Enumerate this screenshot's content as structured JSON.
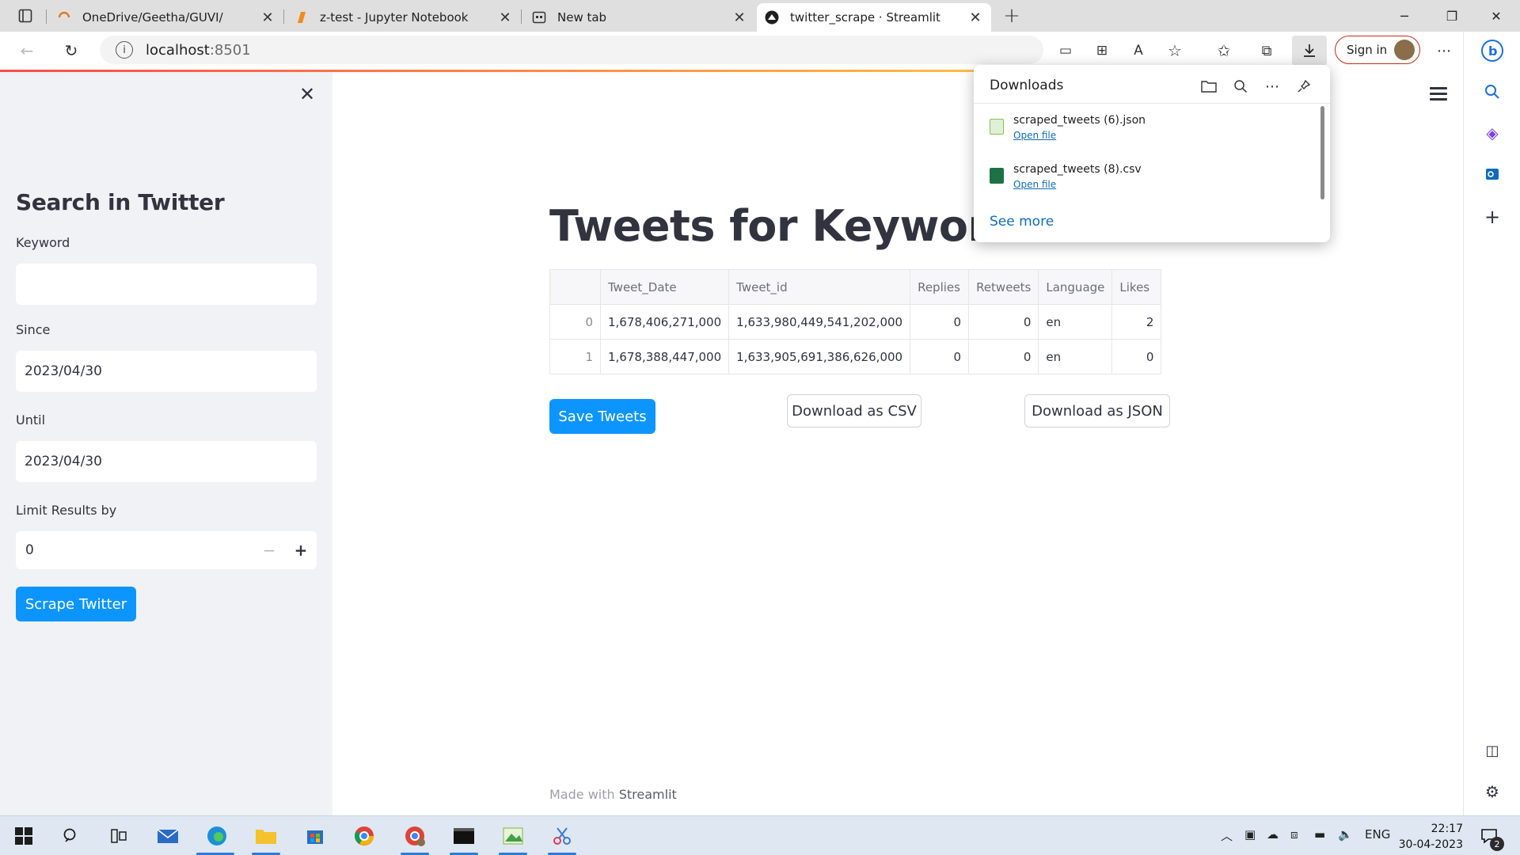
{
  "browser": {
    "tabs": [
      {
        "title": "OneDrive/Geetha/GUVI/",
        "icon": "loading-spinner-icon",
        "active": false
      },
      {
        "title": "z-test - Jupyter Notebook",
        "icon": "jupyter-icon",
        "active": false
      },
      {
        "title": "New tab",
        "icon": "new-tab-icon",
        "active": false
      },
      {
        "title": "twitter_scrape · Streamlit",
        "icon": "streamlit-icon",
        "active": true
      }
    ],
    "url_host": "localhost",
    "url_port": ":8501",
    "sign_in_label": "Sign in"
  },
  "sidebar": {
    "title": "Search in Twitter",
    "keyword_label": "Keyword",
    "keyword_value": "",
    "since_label": "Since",
    "since_value": "2023/04/30",
    "until_label": "Until",
    "until_value": "2023/04/30",
    "limit_label": "Limit Results by",
    "limit_value": "0",
    "scrape_button": "Scrape Twitter"
  },
  "main": {
    "title": "Tweets for Keyword",
    "table": {
      "columns": [
        "",
        "Tweet_Date",
        "Tweet_id",
        "Replies",
        "Retweets",
        "Language",
        "Likes"
      ],
      "rows": [
        [
          "0",
          "1,678,406,271,000",
          "1,633,980,449,541,202,000",
          "0",
          "0",
          "en",
          "2"
        ],
        [
          "1",
          "1,678,388,447,000",
          "1,633,905,691,386,626,000",
          "0",
          "0",
          "en",
          "0"
        ]
      ]
    },
    "save_button": "Save Tweets",
    "csv_button": "Download as CSV",
    "json_button": "Download as JSON",
    "footer_prefix": "Made with",
    "footer_brand": "Streamlit"
  },
  "downloads": {
    "title": "Downloads",
    "items": [
      {
        "filename": "scraped_tweets (6).json",
        "action": "Open file",
        "icon": "json-file-icon"
      },
      {
        "filename": "scraped_tweets (8).csv",
        "action": "Open file",
        "icon": "excel-file-icon"
      }
    ],
    "see_more": "See more"
  },
  "taskbar": {
    "language": "ENG",
    "time": "22:17",
    "date": "30-04-2023",
    "notification_count": "2"
  },
  "colors": {
    "primary_button": "#0d95ff",
    "sidebar_bg": "#f0f2f6",
    "title_text": "#31333f",
    "link": "#0f6cbd",
    "signin_border": "#c42b1c"
  }
}
